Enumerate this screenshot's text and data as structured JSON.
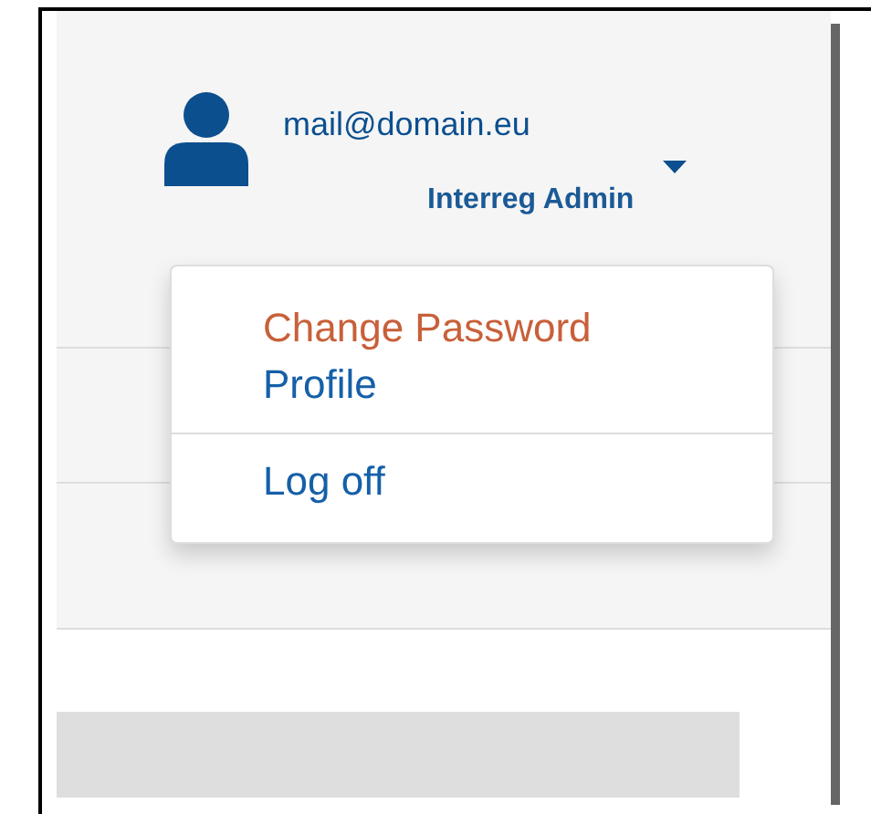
{
  "user": {
    "email": "mail@domain.eu",
    "role": "Interreg Admin"
  },
  "menu": {
    "expanded": true,
    "items": [
      {
        "label": "Change Password",
        "selected": true,
        "separator_before": false
      },
      {
        "label": "Profile",
        "selected": false,
        "separator_before": false
      },
      {
        "label": "Log off",
        "selected": false,
        "separator_before": true
      }
    ]
  }
}
